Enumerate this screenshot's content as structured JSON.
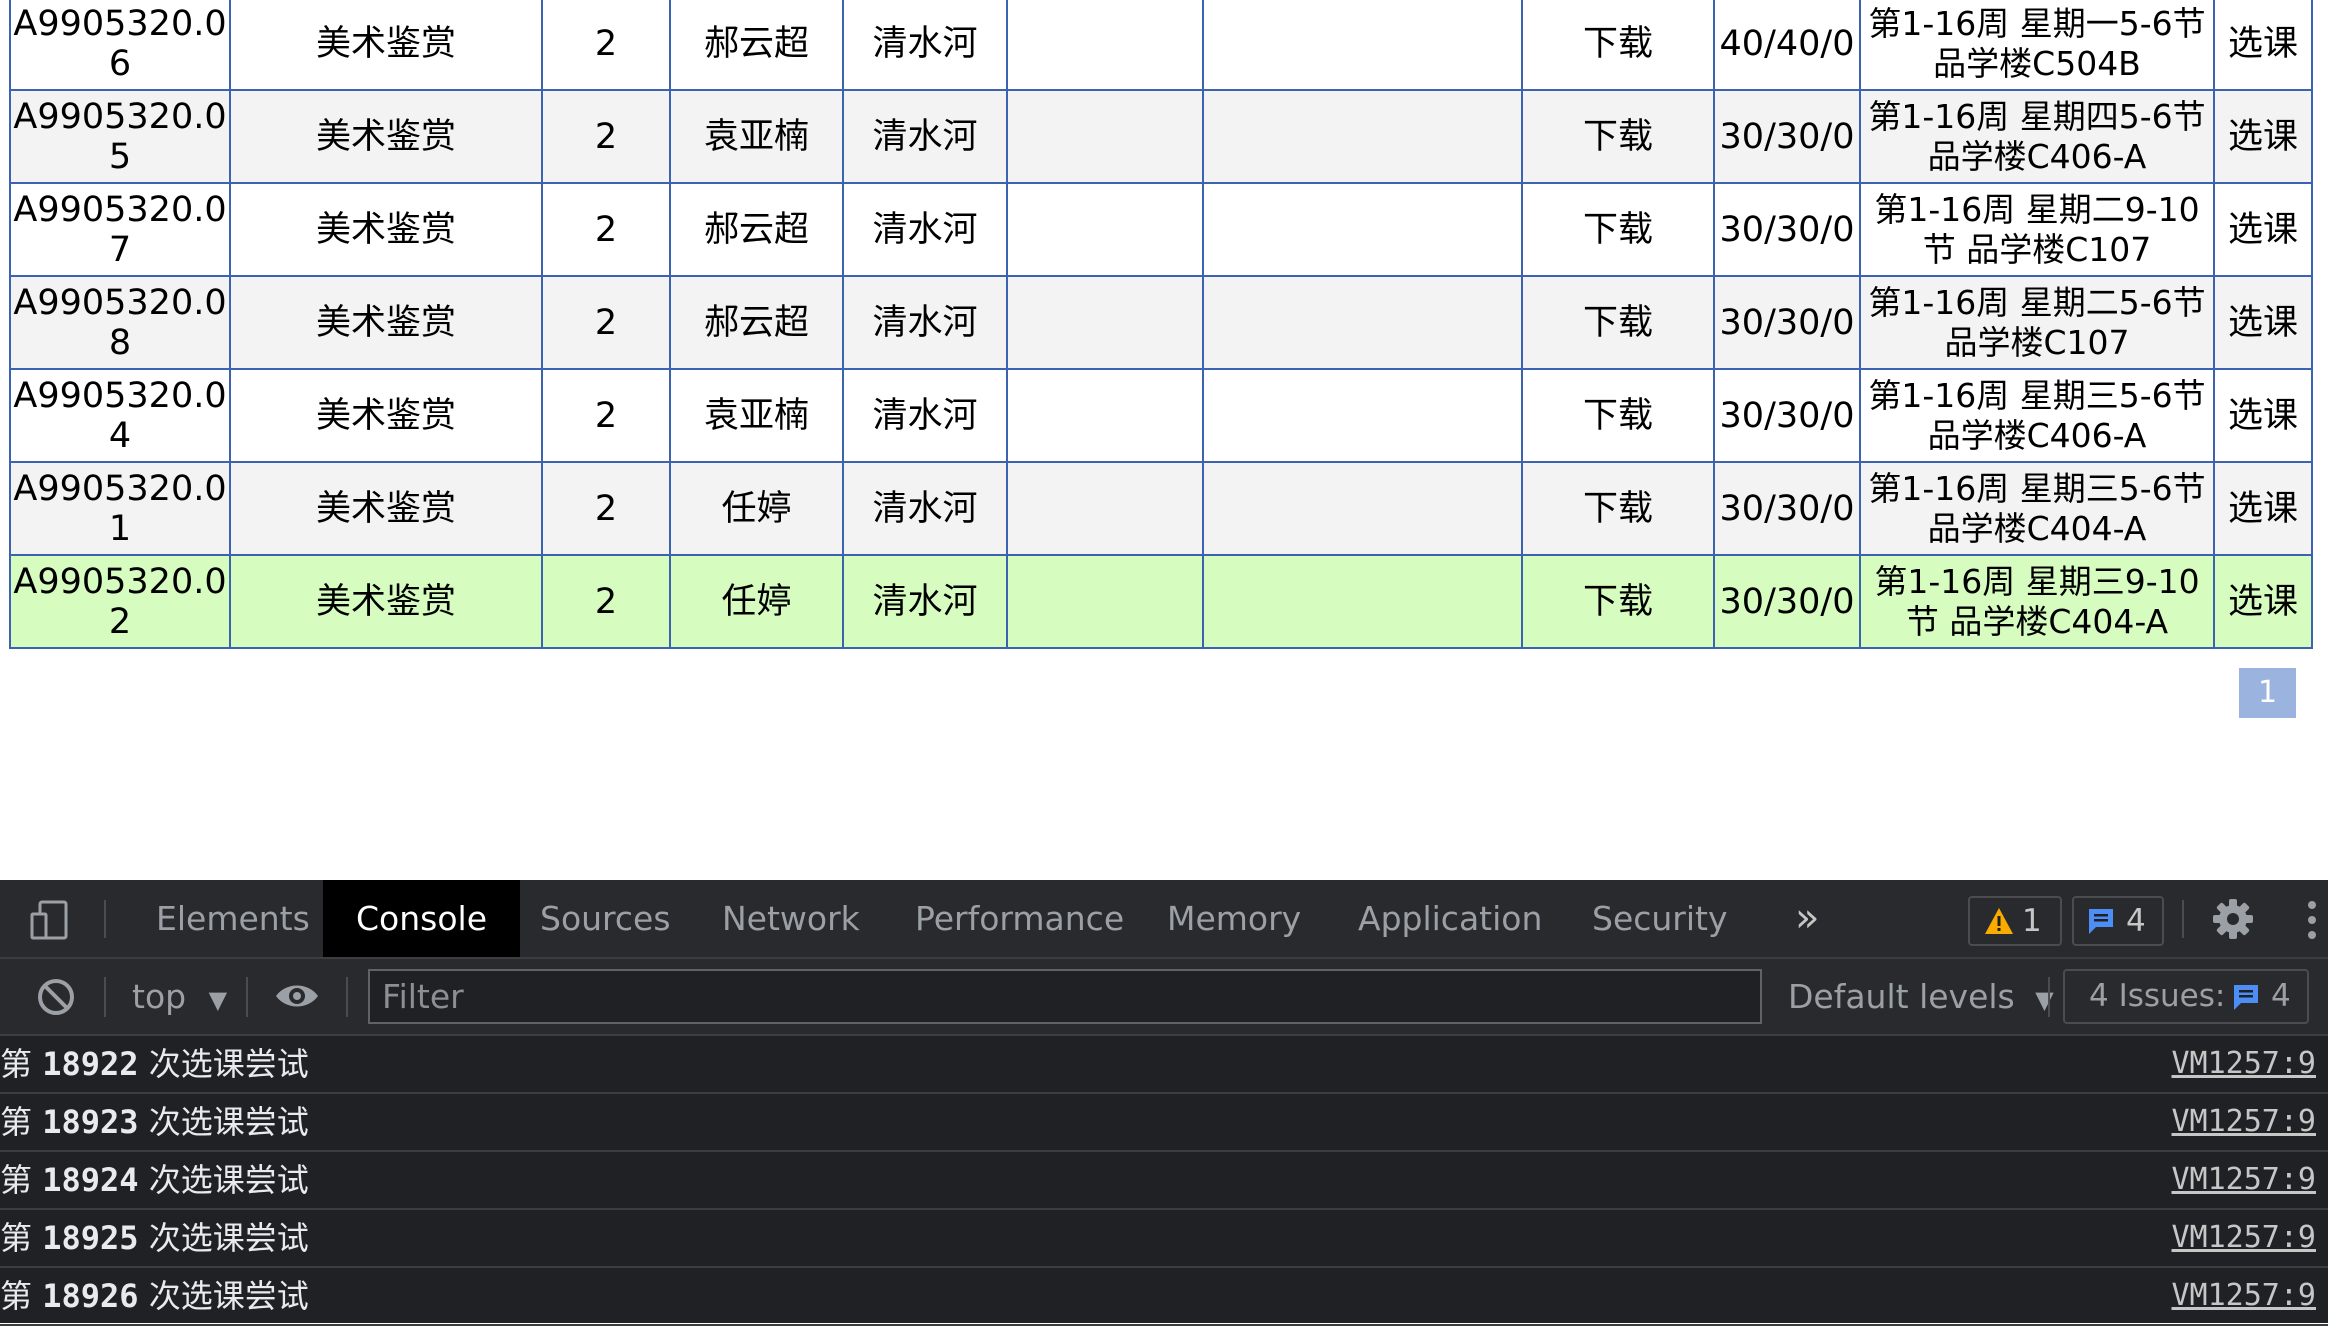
{
  "table": {
    "rows": [
      {
        "code": "A9905320.06",
        "course": "美术鉴赏",
        "credits": "2",
        "teacher": "郝云超",
        "campus": "清水河",
        "col6": "",
        "col7": "",
        "download": "下载",
        "capacity": "40/40/0",
        "schedule": "第1-16周 星期一5-6节 品学楼C504B",
        "action": "选课",
        "selected": false
      },
      {
        "code": "A9905320.05",
        "course": "美术鉴赏",
        "credits": "2",
        "teacher": "袁亚楠",
        "campus": "清水河",
        "col6": "",
        "col7": "",
        "download": "下载",
        "capacity": "30/30/0",
        "schedule": "第1-16周 星期四5-6节 品学楼C406-A",
        "action": "选课",
        "selected": false
      },
      {
        "code": "A9905320.07",
        "course": "美术鉴赏",
        "credits": "2",
        "teacher": "郝云超",
        "campus": "清水河",
        "col6": "",
        "col7": "",
        "download": "下载",
        "capacity": "30/30/0",
        "schedule": "第1-16周 星期二9-10节 品学楼C107",
        "action": "选课",
        "selected": false
      },
      {
        "code": "A9905320.08",
        "course": "美术鉴赏",
        "credits": "2",
        "teacher": "郝云超",
        "campus": "清水河",
        "col6": "",
        "col7": "",
        "download": "下载",
        "capacity": "30/30/0",
        "schedule": "第1-16周 星期二5-6节 品学楼C107",
        "action": "选课",
        "selected": false
      },
      {
        "code": "A9905320.04",
        "course": "美术鉴赏",
        "credits": "2",
        "teacher": "袁亚楠",
        "campus": "清水河",
        "col6": "",
        "col7": "",
        "download": "下载",
        "capacity": "30/30/0",
        "schedule": "第1-16周 星期三5-6节 品学楼C406-A",
        "action": "选课",
        "selected": false
      },
      {
        "code": "A9905320.01",
        "course": "美术鉴赏",
        "credits": "2",
        "teacher": "任婷",
        "campus": "清水河",
        "col6": "",
        "col7": "",
        "download": "下载",
        "capacity": "30/30/0",
        "schedule": "第1-16周 星期三5-6节 品学楼C404-A",
        "action": "选课",
        "selected": false
      },
      {
        "code": "A9905320.02",
        "course": "美术鉴赏",
        "credits": "2",
        "teacher": "任婷",
        "campus": "清水河",
        "col6": "",
        "col7": "",
        "download": "下载",
        "capacity": "30/30/0",
        "schedule": "第1-16周 星期三9-10节 品学楼C404-A",
        "action": "选课",
        "selected": true
      }
    ]
  },
  "pagination": {
    "current_page": "1"
  },
  "devtools": {
    "tabs": [
      "Elements",
      "Console",
      "Sources",
      "Network",
      "Performance",
      "Memory",
      "Application",
      "Security"
    ],
    "active_tab": "Console",
    "more_tabs_icon": "double-chevron-right-icon",
    "warning_count": "1",
    "message_count": "4",
    "toolbar": {
      "context": "top",
      "filter_placeholder": "Filter",
      "levels": "Default levels",
      "issues_label": "4 Issues:",
      "issues_count": "4"
    },
    "console": [
      {
        "prefix": "第 ",
        "num": "18922",
        "suffix": " 次选课尝试",
        "source": "VM1257:9"
      },
      {
        "prefix": "第 ",
        "num": "18923",
        "suffix": " 次选课尝试",
        "source": "VM1257:9"
      },
      {
        "prefix": "第 ",
        "num": "18924",
        "suffix": " 次选课尝试",
        "source": "VM1257:9"
      },
      {
        "prefix": "第 ",
        "num": "18925",
        "suffix": " 次选课尝试",
        "source": "VM1257:9"
      },
      {
        "prefix": "第 ",
        "num": "18926",
        "suffix": " 次选课尝试",
        "source": "VM1257:9"
      }
    ],
    "colors": {
      "panel_bg": "#202124",
      "selected_row": "#d6fcc0",
      "link": "#1d21a0",
      "border": "#3b63b0"
    }
  }
}
